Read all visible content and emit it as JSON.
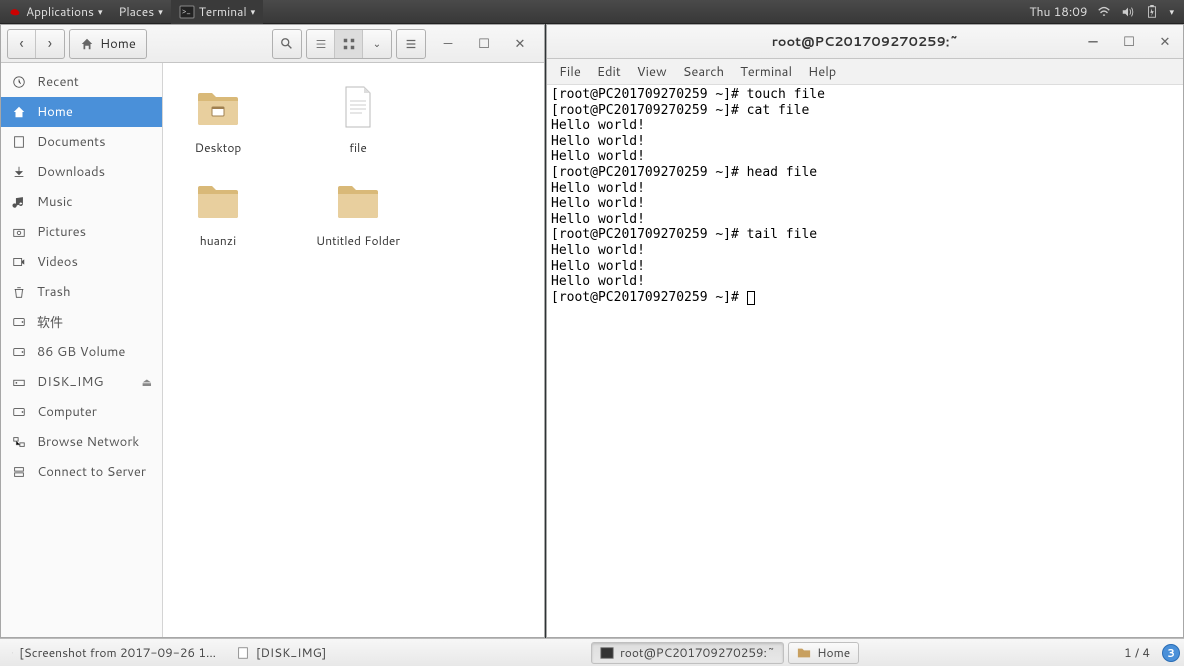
{
  "top_panel": {
    "applications": "Applications",
    "places": "Places",
    "terminal": "Terminal",
    "clock": "Thu 18:09"
  },
  "files": {
    "nav_home": "Home",
    "sidebar": [
      {
        "icon": "clock",
        "label": "Recent"
      },
      {
        "icon": "home",
        "label": "Home"
      },
      {
        "icon": "doc",
        "label": "Documents"
      },
      {
        "icon": "download",
        "label": "Downloads"
      },
      {
        "icon": "music",
        "label": "Music"
      },
      {
        "icon": "camera",
        "label": "Pictures"
      },
      {
        "icon": "video",
        "label": "Videos"
      },
      {
        "icon": "trash",
        "label": "Trash"
      },
      {
        "icon": "disk",
        "label": "软件"
      },
      {
        "icon": "disk",
        "label": "86 GB Volume"
      },
      {
        "icon": "drive",
        "label": "DISK_IMG"
      },
      {
        "icon": "disk",
        "label": "Computer"
      },
      {
        "icon": "network",
        "label": "Browse Network"
      },
      {
        "icon": "server",
        "label": "Connect to Server"
      }
    ],
    "items": [
      {
        "type": "folder-desktop",
        "name": "Desktop"
      },
      {
        "type": "textfile",
        "name": "file"
      },
      {
        "type": "folder",
        "name": "huanzi"
      },
      {
        "type": "folder",
        "name": "Untitled Folder"
      }
    ]
  },
  "terminal": {
    "title": "root@PC201709270259:~",
    "menus": [
      "File",
      "Edit",
      "View",
      "Search",
      "Terminal",
      "Help"
    ],
    "lines": [
      "[root@PC201709270259 ~]# touch file",
      "[root@PC201709270259 ~]# cat file",
      "Hello world!",
      "Hello world!",
      "Hello world!",
      "[root@PC201709270259 ~]# head file",
      "Hello world!",
      "Hello world!",
      "Hello world!",
      "[root@PC201709270259 ~]# tail file",
      "Hello world!",
      "Hello world!",
      "Hello world!",
      "[root@PC201709270259 ~]# "
    ]
  },
  "taskbar": {
    "items": [
      {
        "icon": "search",
        "label": "[Screenshot from 2017-09-26 1...",
        "active": false
      },
      {
        "icon": "doc",
        "label": "[DISK_IMG]",
        "active": false
      },
      {
        "icon": "term",
        "label": "root@PC201709270259:~",
        "active": true
      },
      {
        "icon": "folder",
        "label": "Home",
        "active": false
      }
    ],
    "workspace": "1 / 4",
    "notif": "3"
  }
}
